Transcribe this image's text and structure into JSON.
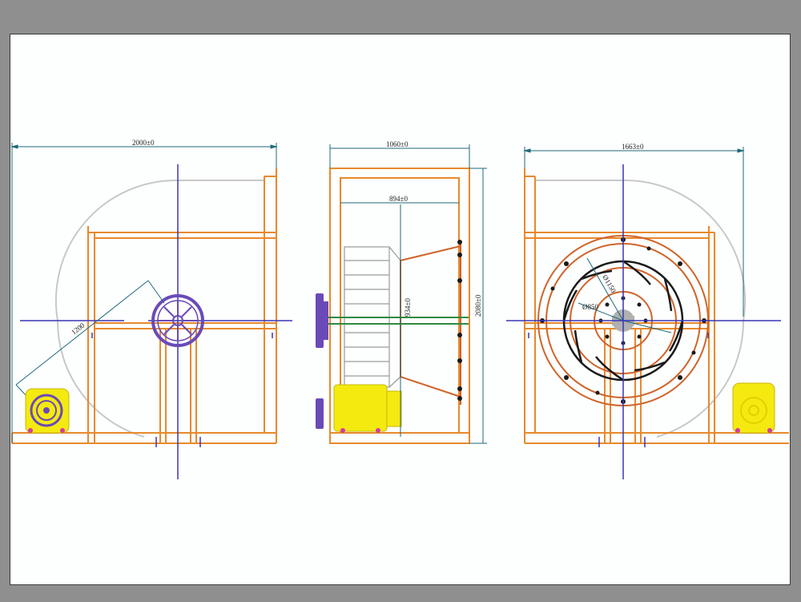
{
  "colors": {
    "frame": "#e8892c",
    "frame_dark": "#d0642a",
    "axis": "#3b35b5",
    "dimension": "#1e6a78",
    "housing": "#c8c8c8",
    "motor": "#f4ea10",
    "impeller": "#6a4ab8",
    "shaft": "#2e8b3e",
    "blade": "#1a1a1a"
  },
  "views": {
    "left": {
      "width_label": "2000±0",
      "diag_label": "1200"
    },
    "middle": {
      "width_label": "1060±0",
      "inner_width_label": "894±0",
      "inlet_height_label": "934±0",
      "height_label": "2080±0"
    },
    "right": {
      "width_label": "1663±0",
      "radius_outer_label": "Ø1150",
      "radius_inner_label": "Ø850"
    }
  }
}
